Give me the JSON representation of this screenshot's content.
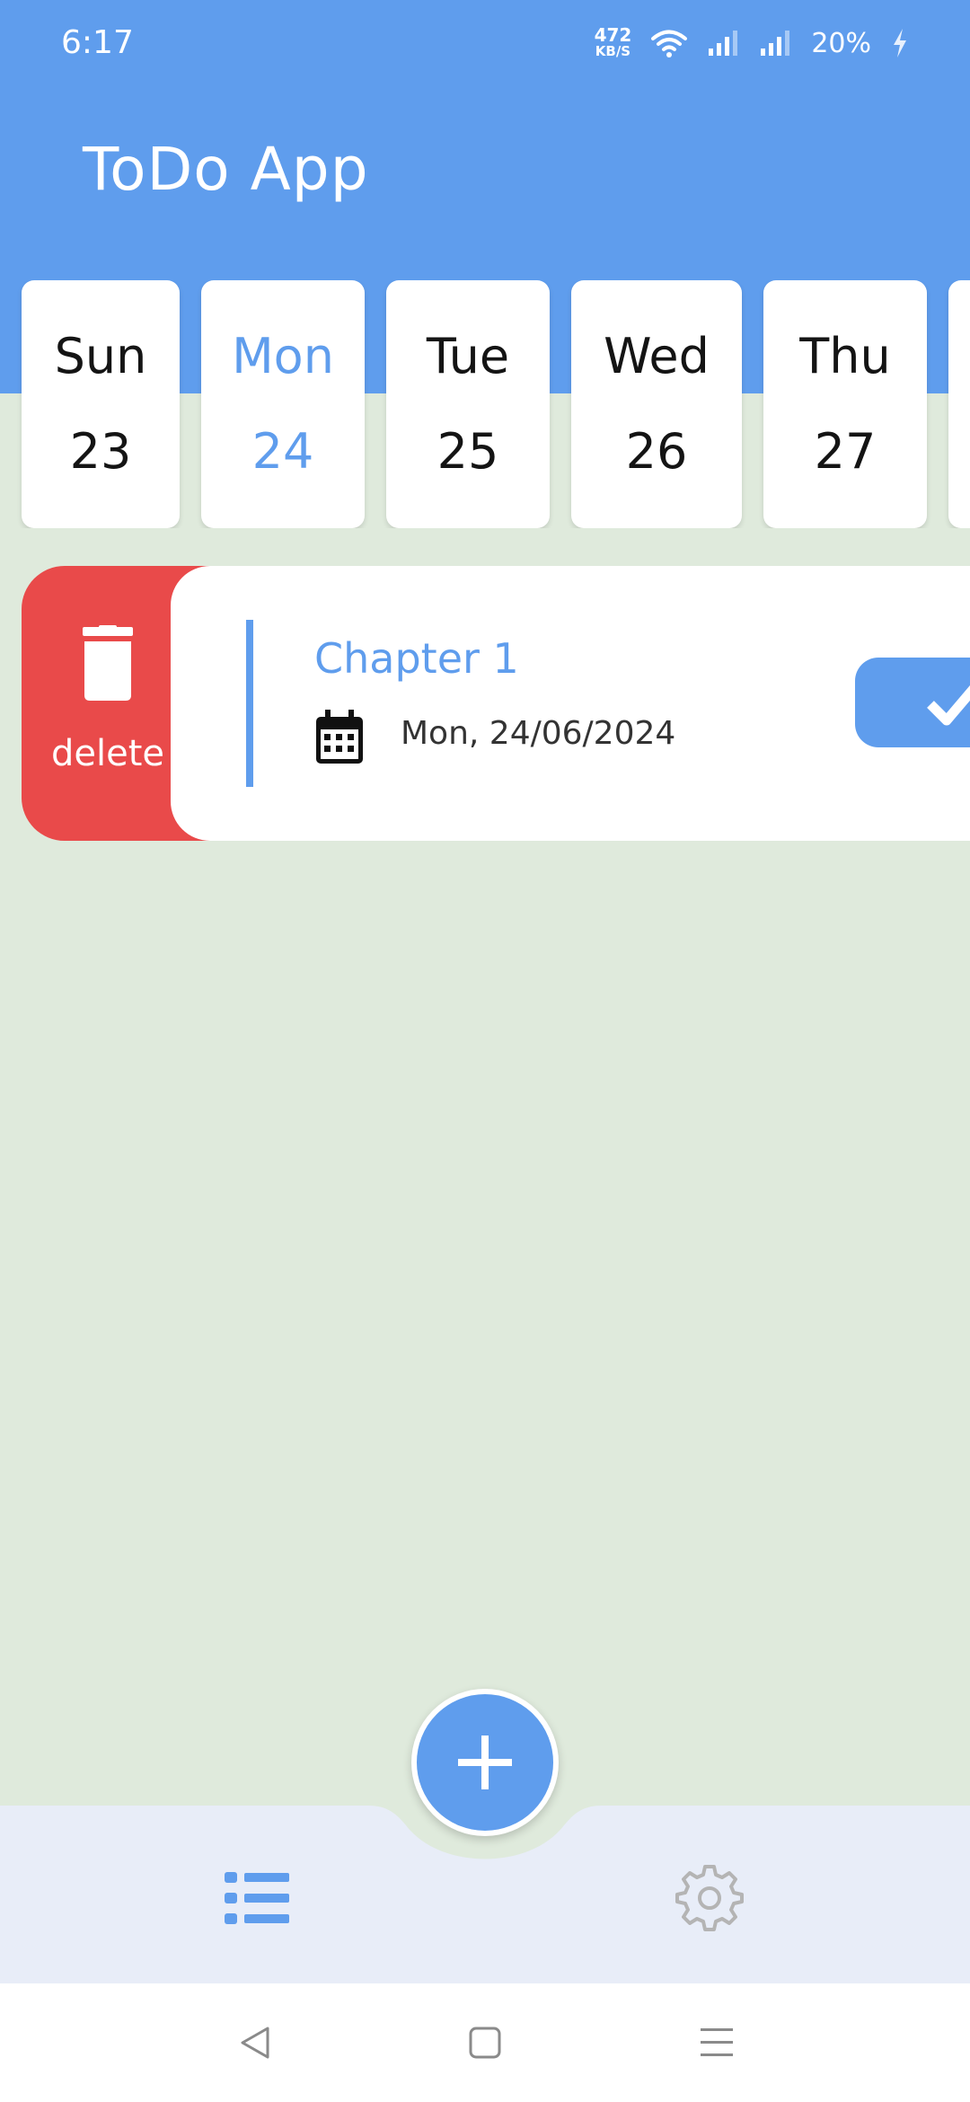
{
  "status_bar": {
    "time": "6:17",
    "net_speed_value": "472",
    "net_speed_unit": "KB/S",
    "battery_percent": "20%"
  },
  "app": {
    "title": "ToDo App"
  },
  "days": [
    {
      "name": "Sun",
      "date": "23",
      "selected": false
    },
    {
      "name": "Mon",
      "date": "24",
      "selected": true
    },
    {
      "name": "Tue",
      "date": "25",
      "selected": false
    },
    {
      "name": "Wed",
      "date": "26",
      "selected": false
    },
    {
      "name": "Thu",
      "date": "27",
      "selected": false
    }
  ],
  "task": {
    "delete_label": "delete",
    "title": "Chapter 1",
    "date": "Mon, 24/06/2024"
  },
  "colors": {
    "accent": "#5f9ded",
    "delete": "#e94a4a",
    "background": "#dfeadc",
    "nav_background": "#e8edf8"
  },
  "icons": {
    "delete": "trash-icon",
    "date": "calendar-icon",
    "complete": "checkmark-icon",
    "add": "plus-icon",
    "nav_tasks": "list-icon",
    "nav_settings": "gear-icon"
  }
}
